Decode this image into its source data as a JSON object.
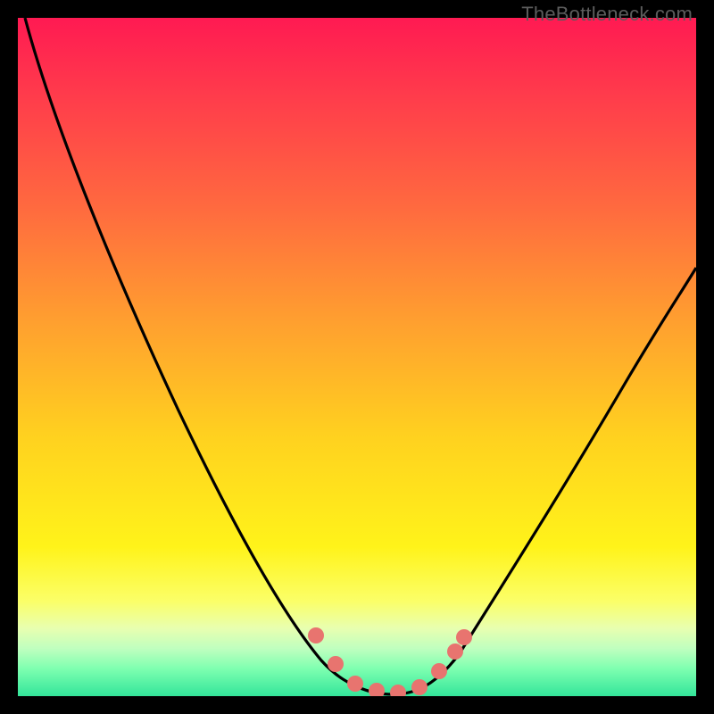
{
  "watermark": "TheBottleneck.com",
  "colors": {
    "background": "#000000",
    "gradient_top": "#ff1a52",
    "gradient_bottom": "#33e59a",
    "curve": "#000000",
    "markers": "#e8746f"
  },
  "chart_data": {
    "type": "line",
    "title": "",
    "xlabel": "",
    "ylabel": "",
    "xlim": [
      0,
      100
    ],
    "ylim": [
      0,
      100
    ],
    "grid": false,
    "legend": false,
    "series": [
      {
        "name": "bottleneck-curve",
        "x": [
          1,
          10,
          20,
          30,
          38,
          44,
          48,
          52,
          55,
          58,
          62,
          66,
          72,
          80,
          90,
          100
        ],
        "y": [
          100,
          76,
          55,
          36,
          20,
          9,
          4,
          1,
          0,
          1,
          3,
          8,
          17,
          30,
          47,
          64
        ]
      }
    ],
    "markers": {
      "name": "highlighted-points",
      "x": [
        44,
        47,
        50,
        53,
        56,
        59,
        62,
        64,
        65
      ],
      "y": [
        9,
        5,
        2,
        1,
        1,
        2,
        4,
        7,
        9
      ]
    }
  }
}
